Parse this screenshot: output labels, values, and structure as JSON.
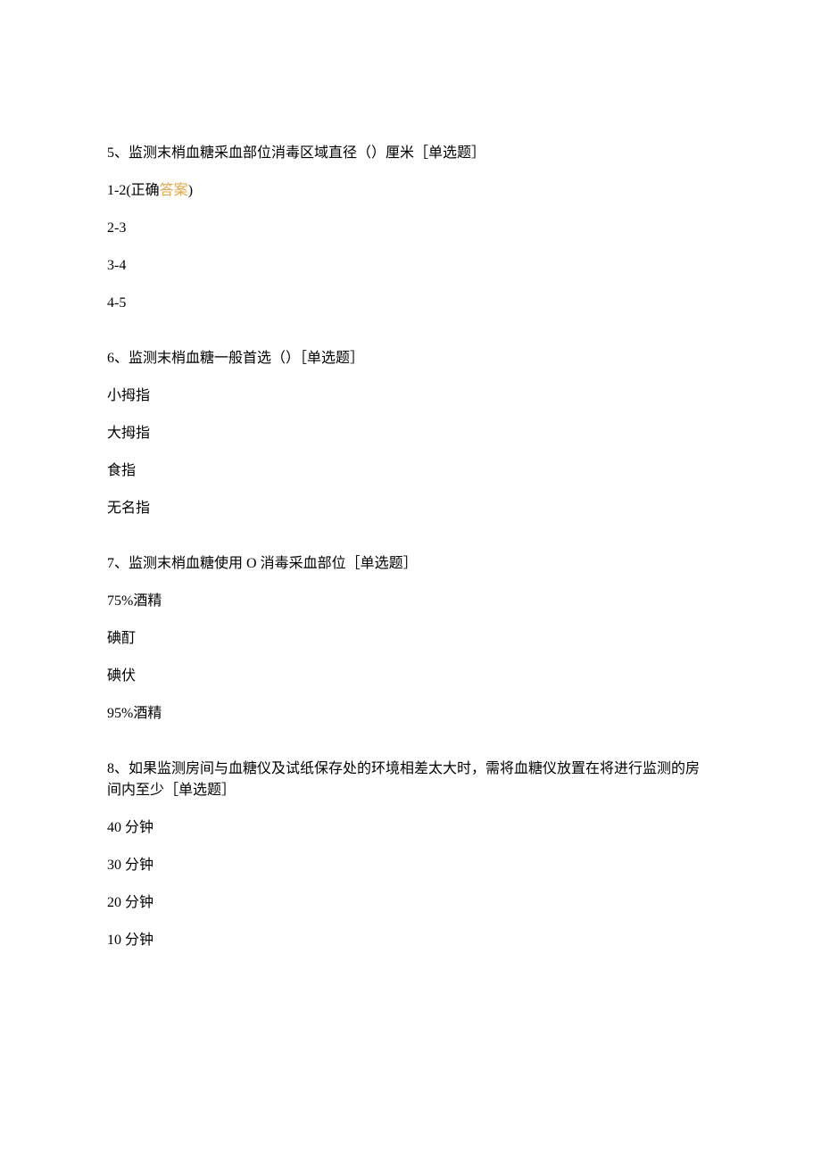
{
  "questions": [
    {
      "number": "5、",
      "text": "监测末梢血糖采血部位消毒区域直径（）厘米［单选题］",
      "options": [
        {
          "prefix_latin": "1-2(",
          "prefix_cn": "正确",
          "answer": "答案",
          "suffix": ")"
        },
        {
          "latin": "2-3"
        },
        {
          "latin": "3-4"
        },
        {
          "latin": "4-5"
        }
      ]
    },
    {
      "number": "6、",
      "text": "监测末梢血糖一般首选（）［单选题］",
      "options": [
        {
          "cn": "小拇指"
        },
        {
          "cn": "大拇指"
        },
        {
          "cn": "食指"
        },
        {
          "cn": "无名指"
        }
      ]
    },
    {
      "number": "7、",
      "text_pre": "监测末梢血糖使用",
      "text_mid_latin": " O ",
      "text_post": "消毒采血部位［单选题］",
      "options": [
        {
          "latin": "75%",
          "cn": "酒精"
        },
        {
          "cn": "碘酊"
        },
        {
          "cn": "碘伏"
        },
        {
          "latin": "95%",
          "cn": "酒精"
        }
      ]
    },
    {
      "number": "8、",
      "text": "如果监测房间与血糖仪及试纸保存处的环境相差太大时，需将血糖仪放置在将进行监测的房间内至少［单选题］",
      "options": [
        {
          "latin": "40 ",
          "cn": "分钟"
        },
        {
          "latin": "30 ",
          "cn": "分钟"
        },
        {
          "latin": "20 ",
          "cn": "分钟"
        },
        {
          "latin": "10 ",
          "cn": "分钟"
        }
      ]
    }
  ]
}
